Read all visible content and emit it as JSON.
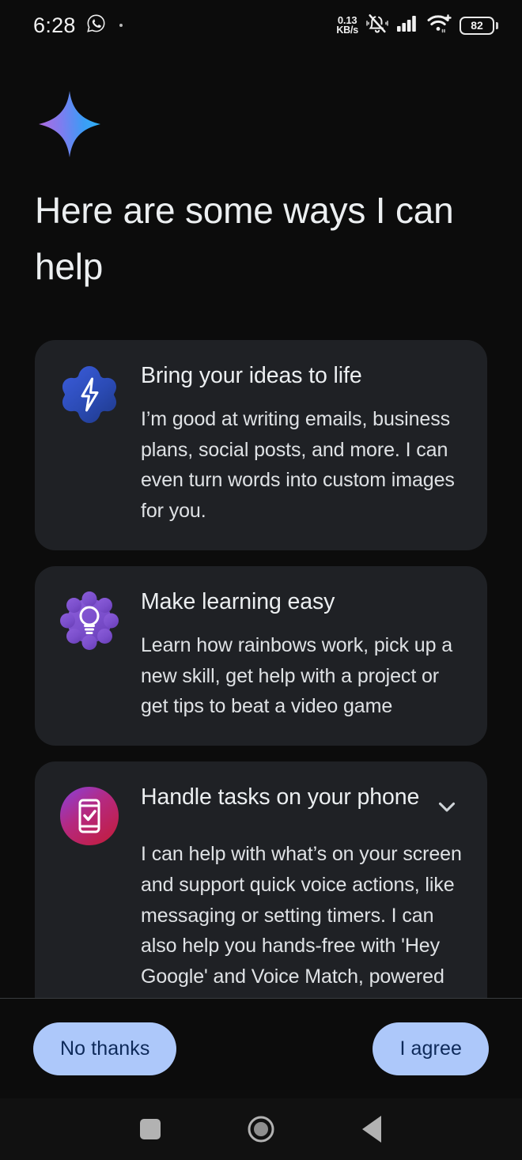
{
  "status_bar": {
    "clock": "6:28",
    "messaging_icon": "whatsapp-icon",
    "notification_dot": "dot-indicator",
    "network_speed_value": "0.13",
    "network_speed_unit": "KB/s",
    "ringer_icon": "bell-muted-icon",
    "signal_icon": "cellular-signal-icon",
    "wifi_icon": "wifi-plus-icon",
    "battery_level": "82"
  },
  "header": {
    "brand_icon": "gemini-sparkle-icon",
    "title": "Here are some ways I can help"
  },
  "cards": [
    {
      "icon": "lightning-bolt-icon",
      "title": "Bring your ideas to life",
      "description": "I’m good at writing emails, business plans, social posts, and more. I can even turn words into custom images for you.",
      "expandable": false
    },
    {
      "icon": "lightbulb-icon",
      "title": "Make learning easy",
      "description": "Learn how rainbows work, pick up a new skill, get help with a project or get tips to beat a video game",
      "expandable": false
    },
    {
      "icon": "phone-check-icon",
      "title": "Handle tasks on your phone",
      "description": "I can help with what’s on your screen and support quick voice actions, like messaging or setting timers. I can also help you hands-free with 'Hey Google' and Voice Match, powered by Google Assistant. If you opt in, I’ll replace Google Assistant.",
      "expandable": true,
      "expand_icon": "chevron-down-icon"
    }
  ],
  "actions": {
    "decline_label": "No thanks",
    "accept_label": "I agree"
  },
  "nav_bar": {
    "recents_icon": "square-recents-icon",
    "home_icon": "circle-home-icon",
    "back_icon": "triangle-back-icon"
  },
  "colors": {
    "page_background": "#0c0c0c",
    "card_background": "#1f2125",
    "accent_button": "#adc8fa",
    "accent_button_text": "#0e2a5a",
    "primary_text": "#eceff1"
  }
}
